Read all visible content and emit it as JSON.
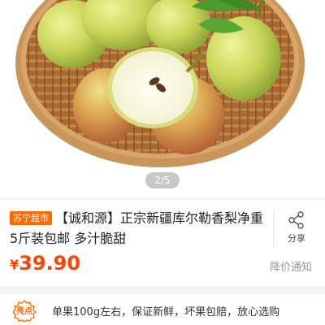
{
  "gallery": {
    "image": "pear-basket-photo",
    "pager": "2/5"
  },
  "product": {
    "store_tag": "苏宁超市",
    "title": "【诚和源】正宗新疆库尔勒香梨净重5斤装包邮 多汁脆甜"
  },
  "share": {
    "icon": "share-icon",
    "label": "分享"
  },
  "price": {
    "currency": "¥",
    "amount": "39.90"
  },
  "price_notice": {
    "label": "降价通知"
  },
  "highlight": {
    "badge": "亮点",
    "text": "单果100g左右，保证新鲜，坏果包赔，放心选购"
  },
  "colors": {
    "accent": "#ff4400",
    "store_tag": "#ff6a00"
  }
}
